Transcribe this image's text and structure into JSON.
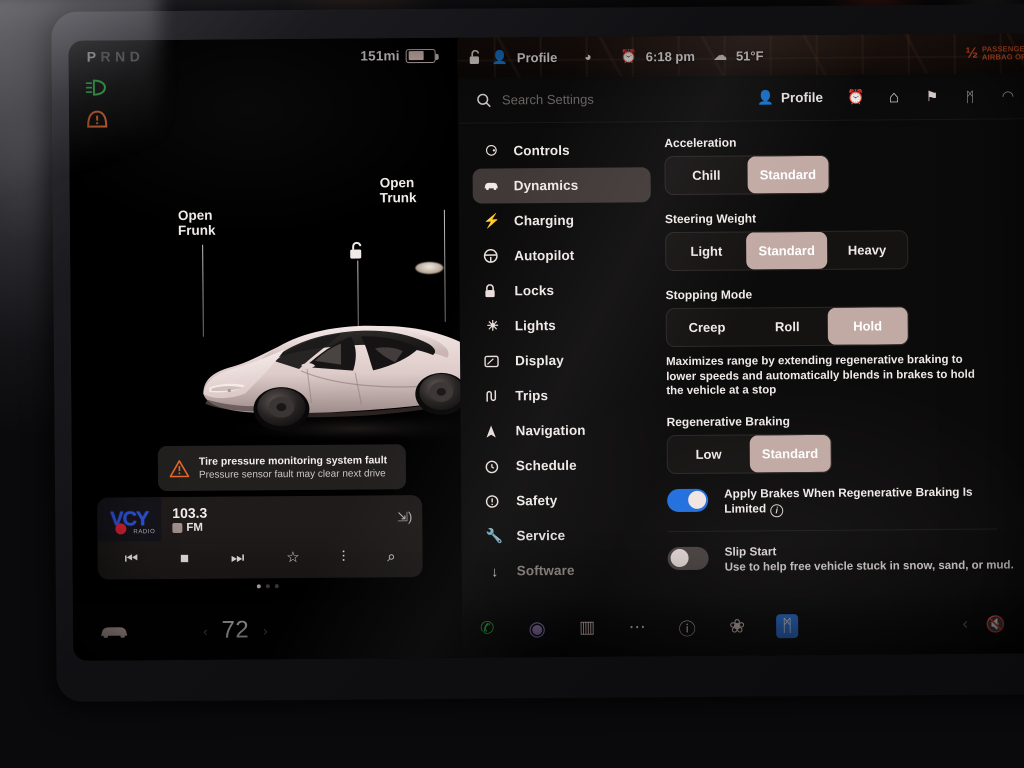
{
  "vehicle_panel": {
    "gear_indicator": {
      "letters": [
        "P",
        "R",
        "N",
        "D"
      ],
      "selected": "P"
    },
    "range": {
      "value": "151",
      "unit": "mi",
      "battery_level_pct": 62
    },
    "telltales": [
      {
        "name": "low-beam-headlight",
        "color": "#2fcc4a"
      },
      {
        "name": "tire-pressure-warning",
        "color": "#e2672a"
      }
    ],
    "callouts": {
      "frunk": "Open\nFrunk",
      "frunk_line1": "Open",
      "frunk_line2": "Frunk",
      "trunk_line1": "Open",
      "trunk_line2": "Trunk",
      "lock_icon": "unlocked-padlock-icon",
      "charge_icon": "charge-bolt-icon"
    },
    "notification": {
      "icon": "warning-triangle-icon",
      "title": "Tire pressure monitoring system fault",
      "subtitle": "Pressure sensor fault may clear next drive"
    },
    "media": {
      "station_logo": "VCY",
      "station_logo_sub": "RADIO",
      "frequency": "103.3",
      "band": "FM",
      "cast_icon": "cast-audio-icon",
      "controls": [
        {
          "name": "previous-track-button",
          "glyph": "⏮"
        },
        {
          "name": "stop-button",
          "glyph": "■"
        },
        {
          "name": "next-track-button",
          "glyph": "⏭"
        },
        {
          "name": "favorite-star-button",
          "glyph": "☆"
        },
        {
          "name": "equalizer-button",
          "glyph": "⫶"
        },
        {
          "name": "search-media-button",
          "glyph": "⌕"
        }
      ],
      "page_dots": 3,
      "page_active": 1
    }
  },
  "status_bar": {
    "lock_icon": "unlocked-padlock-icon",
    "profile_icon": "person-icon",
    "profile_label": "Profile",
    "wifi_icon": "wifi-icon",
    "alarm_icon": "alarm-clock-icon",
    "time": "6:18 pm",
    "weather_icon": "cloud-icon",
    "temperature": "51°F",
    "airbag_symbol": "½",
    "airbag_line1": "PASSENGER",
    "airbag_line2": "AIRBAG OFF",
    "airbag_color": "#e2582a"
  },
  "search": {
    "icon": "search-icon",
    "placeholder": "Search Settings",
    "right_icons": [
      {
        "name": "profile-icon",
        "label": "Profile"
      },
      {
        "name": "alarm-clock-icon",
        "glyph": "⏰",
        "color": "#e2582a"
      },
      {
        "name": "home-icon",
        "glyph": "⌂"
      },
      {
        "name": "notification-bell-icon",
        "glyph": "⚑"
      },
      {
        "name": "bluetooth-icon",
        "glyph": "ᛗ"
      },
      {
        "name": "wifi-icon",
        "glyph": "◠"
      }
    ]
  },
  "sidebar": {
    "items": [
      {
        "label": "Controls",
        "icon": "toggle-switch-icon"
      },
      {
        "label": "Dynamics",
        "icon": "car-icon",
        "active": true
      },
      {
        "label": "Charging",
        "icon": "lightning-bolt-icon"
      },
      {
        "label": "Autopilot",
        "icon": "steering-wheel-icon"
      },
      {
        "label": "Locks",
        "icon": "padlock-icon"
      },
      {
        "label": "Lights",
        "icon": "sun-brightness-icon"
      },
      {
        "label": "Display",
        "icon": "screen-icon"
      },
      {
        "label": "Trips",
        "icon": "route-icon"
      },
      {
        "label": "Navigation",
        "icon": "compass-arrow-icon"
      },
      {
        "label": "Schedule",
        "icon": "clock-icon"
      },
      {
        "label": "Safety",
        "icon": "exclamation-circle-icon"
      },
      {
        "label": "Service",
        "icon": "wrench-icon"
      },
      {
        "label": "Software",
        "icon": "download-arrow-icon",
        "dim": true
      }
    ]
  },
  "settings": {
    "acceleration": {
      "label": "Acceleration",
      "options": [
        "Chill",
        "Standard"
      ],
      "selected": "Standard"
    },
    "steering_weight": {
      "label": "Steering Weight",
      "options": [
        "Light",
        "Standard",
        "Heavy"
      ],
      "selected": "Standard"
    },
    "stopping_mode": {
      "label": "Stopping Mode",
      "options": [
        "Creep",
        "Roll",
        "Hold"
      ],
      "selected": "Hold",
      "description": "Maximizes range by extending regenerative braking to lower speeds and automatically blends in brakes to hold the vehicle at a stop"
    },
    "regenerative_braking": {
      "label": "Regenerative Braking",
      "options": [
        "Low",
        "Standard"
      ],
      "selected": "Standard"
    },
    "apply_brakes_toggle": {
      "title": "Apply Brakes When Regenerative Braking Is Limited",
      "state": "on",
      "info_icon": "info-circle-icon",
      "on_color": "#1f6fe0"
    },
    "slip_start_toggle": {
      "title": "Slip Start",
      "subtitle": "Use to help free vehicle stuck in snow, sand, or mud.",
      "state": "off"
    }
  },
  "bottom_bar": {
    "car_icon": "car-front-icon",
    "temp_left_arrow": "‹",
    "temperature": "72",
    "temp_right_arrow": "›",
    "icons": [
      {
        "name": "phone-icon",
        "glyph": "✆",
        "color": "#2fcc4a"
      },
      {
        "name": "camera-icon",
        "glyph": "◉",
        "color": "#9b7fc4"
      },
      {
        "name": "seat-heater-icon",
        "glyph": "▥",
        "color": "#e8cfcb"
      },
      {
        "name": "more-dots-icon",
        "glyph": "⋯",
        "color": "#e9e2e0"
      },
      {
        "name": "manual-book-icon",
        "glyph": "ⓘ",
        "color": "#e8cfcb"
      },
      {
        "name": "fan-icon",
        "glyph": "❀",
        "color": "#e8cfcb"
      },
      {
        "name": "bluetooth-icon",
        "glyph": "ᛗ",
        "color": "#2b7cf0"
      }
    ],
    "volume": {
      "left_arrow": "‹",
      "mute_icon": "volume-mute-icon",
      "right_arrow": "›"
    }
  }
}
